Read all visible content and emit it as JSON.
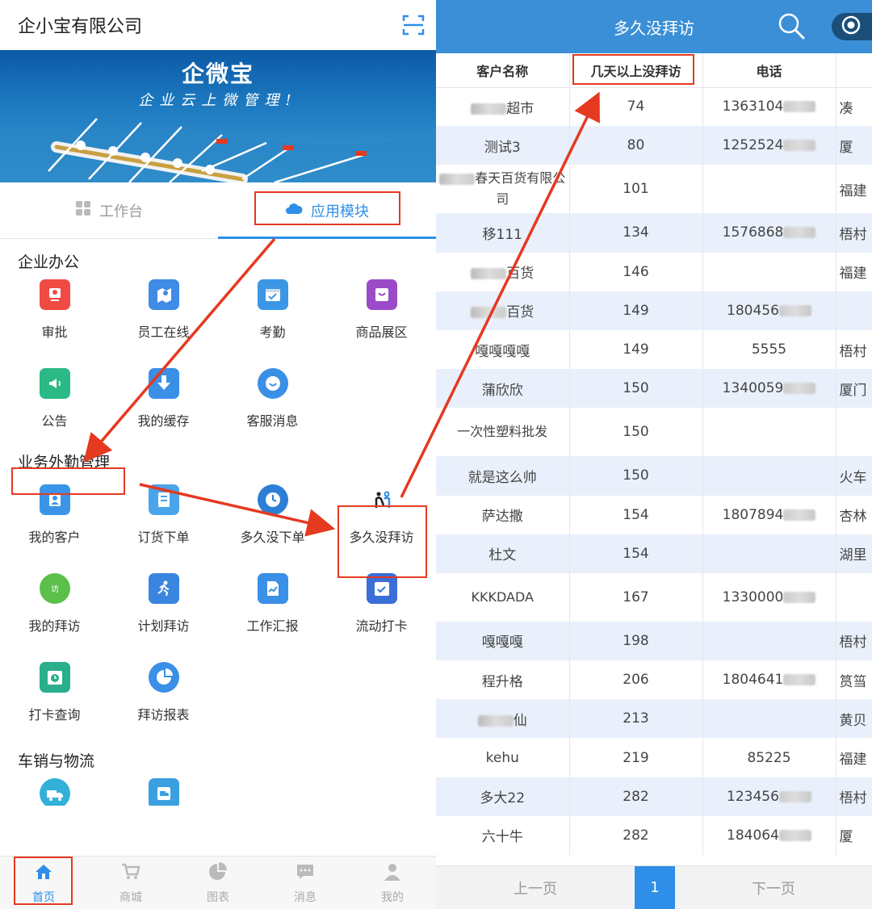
{
  "left": {
    "company_title": "企小宝有限公司",
    "banner": {
      "logo": "企微宝",
      "slogan": "企业云上微管理!"
    },
    "tabs": [
      {
        "label": "工作台",
        "icon": "grid-icon",
        "active": false
      },
      {
        "label": "应用模块",
        "icon": "cloud-icon",
        "active": true
      }
    ],
    "sections": [
      {
        "title": "企业办公",
        "items": [
          {
            "label": "审批",
            "icon": "approval-icon",
            "color": "#ef4a43"
          },
          {
            "label": "员工在线",
            "icon": "map-icon",
            "color": "#3f8be6"
          },
          {
            "label": "考勤",
            "icon": "calendar-icon",
            "color": "#3b97e6"
          },
          {
            "label": "商品展区",
            "icon": "product-icon",
            "color": "#9b4bc8"
          },
          {
            "label": "公告",
            "icon": "announce-icon",
            "color": "#2bba86"
          },
          {
            "label": "我的缓存",
            "icon": "download-icon",
            "color": "#3a8fe6"
          },
          {
            "label": "客服消息",
            "icon": "chat-icon",
            "color": "#3a8fe6"
          }
        ]
      },
      {
        "title": "业务外勤管理",
        "items": [
          {
            "label": "我的客户",
            "icon": "customer-icon",
            "color": "#3a95e8"
          },
          {
            "label": "订货下单",
            "icon": "order-icon",
            "color": "#4aa4ea"
          },
          {
            "label": "多久没下单",
            "icon": "clock-icon",
            "color": "#2d7fd6"
          },
          {
            "label": "多久没拜访",
            "icon": "visit-people-icon",
            "color": "#2d7fd6"
          },
          {
            "label": "我的拜访",
            "icon": "visit-icon",
            "color": "#5bbf4a"
          },
          {
            "label": "计划拜访",
            "icon": "run-icon",
            "color": "#3a85e0"
          },
          {
            "label": "工作汇报",
            "icon": "report-icon",
            "color": "#3a8fe6"
          },
          {
            "label": "流动打卡",
            "icon": "checkin-icon",
            "color": "#3a6fd8"
          },
          {
            "label": "打卡查询",
            "icon": "checkin-query-icon",
            "color": "#2aae8c"
          },
          {
            "label": "拜访报表",
            "icon": "pie-icon",
            "color": "#3a8fe6"
          }
        ]
      },
      {
        "title": "车销与物流",
        "items": [
          {
            "label": "",
            "icon": "truck-icon",
            "color": "#32b0d8"
          },
          {
            "label": "",
            "icon": "delivery-icon",
            "color": "#3aa0e0"
          }
        ]
      }
    ],
    "bottom_nav": [
      {
        "label": "首页",
        "icon": "home-icon",
        "active": true
      },
      {
        "label": "商城",
        "icon": "cart-icon",
        "active": false
      },
      {
        "label": "图表",
        "icon": "chart-icon",
        "active": false
      },
      {
        "label": "消息",
        "icon": "message-icon",
        "active": false
      },
      {
        "label": "我的",
        "icon": "user-icon",
        "active": false
      }
    ]
  },
  "right": {
    "title": "多久没拜访",
    "columns": [
      "客户名称",
      "几天以上没拜访",
      "电话",
      ""
    ],
    "rows": [
      {
        "name": "超市",
        "name_blur": true,
        "days": "74",
        "phone": "1363104",
        "phone_blur": true,
        "addr": "凑"
      },
      {
        "name": "测试3",
        "name_blur": false,
        "days": "80",
        "phone": "1252524",
        "phone_blur": true,
        "addr": "厦"
      },
      {
        "name": "春天百货有限公司",
        "name_blur": true,
        "days": "101",
        "phone": "",
        "phone_blur": false,
        "addr": "福建"
      },
      {
        "name": "移111",
        "name_blur": false,
        "days": "134",
        "phone": "1576868",
        "phone_blur": true,
        "addr": "梧村"
      },
      {
        "name": "百货",
        "name_blur": true,
        "days": "146",
        "phone": "",
        "phone_blur": false,
        "addr": "福建"
      },
      {
        "name": "百货",
        "name_blur": true,
        "days": "149",
        "phone": "180456",
        "phone_blur": true,
        "addr": ""
      },
      {
        "name": "嘎嘎嘎嘎",
        "name_blur": false,
        "days": "149",
        "phone": "5555",
        "phone_blur": false,
        "addr": "梧村"
      },
      {
        "name": "蒲欣欣",
        "name_blur": false,
        "days": "150",
        "phone": "1340059",
        "phone_blur": true,
        "addr": "厦门"
      },
      {
        "name": "一次性塑料批发",
        "name_blur": false,
        "days": "150",
        "phone": "",
        "phone_blur": false,
        "addr": ""
      },
      {
        "name": "就是这么帅",
        "name_blur": false,
        "days": "150",
        "phone": "",
        "phone_blur": false,
        "addr": "火车"
      },
      {
        "name": "萨达撒",
        "name_blur": false,
        "days": "154",
        "phone": "1807894",
        "phone_blur": true,
        "addr": "杏林"
      },
      {
        "name": "杜文",
        "name_blur": false,
        "days": "154",
        "phone": "",
        "phone_blur": false,
        "addr": "湖里"
      },
      {
        "name": "KKKDADA",
        "name_blur": false,
        "days": "167",
        "phone": "1330000",
        "phone_blur": true,
        "addr": ""
      },
      {
        "name": "嘎嘎嘎",
        "name_blur": false,
        "days": "198",
        "phone": "",
        "phone_blur": false,
        "addr": "梧村"
      },
      {
        "name": "程升格",
        "name_blur": false,
        "days": "206",
        "phone": "1804641",
        "phone_blur": true,
        "addr": "筼筜"
      },
      {
        "name": "仙",
        "name_blur": true,
        "days": "213",
        "phone": "",
        "phone_blur": false,
        "addr": "黄贝"
      },
      {
        "name": "kehu",
        "name_blur": false,
        "days": "219",
        "phone": "85225",
        "phone_blur": false,
        "addr": "福建"
      },
      {
        "name": "多大22",
        "name_blur": false,
        "days": "282",
        "phone": "123456",
        "phone_blur": true,
        "addr": "梧村"
      },
      {
        "name": "六十牛",
        "name_blur": false,
        "days": "282",
        "phone": "184064",
        "phone_blur": true,
        "addr": "厦"
      }
    ],
    "pager": {
      "prev": "上一页",
      "page": "1",
      "next": "下一页"
    }
  },
  "annotation_color": "#e53920"
}
